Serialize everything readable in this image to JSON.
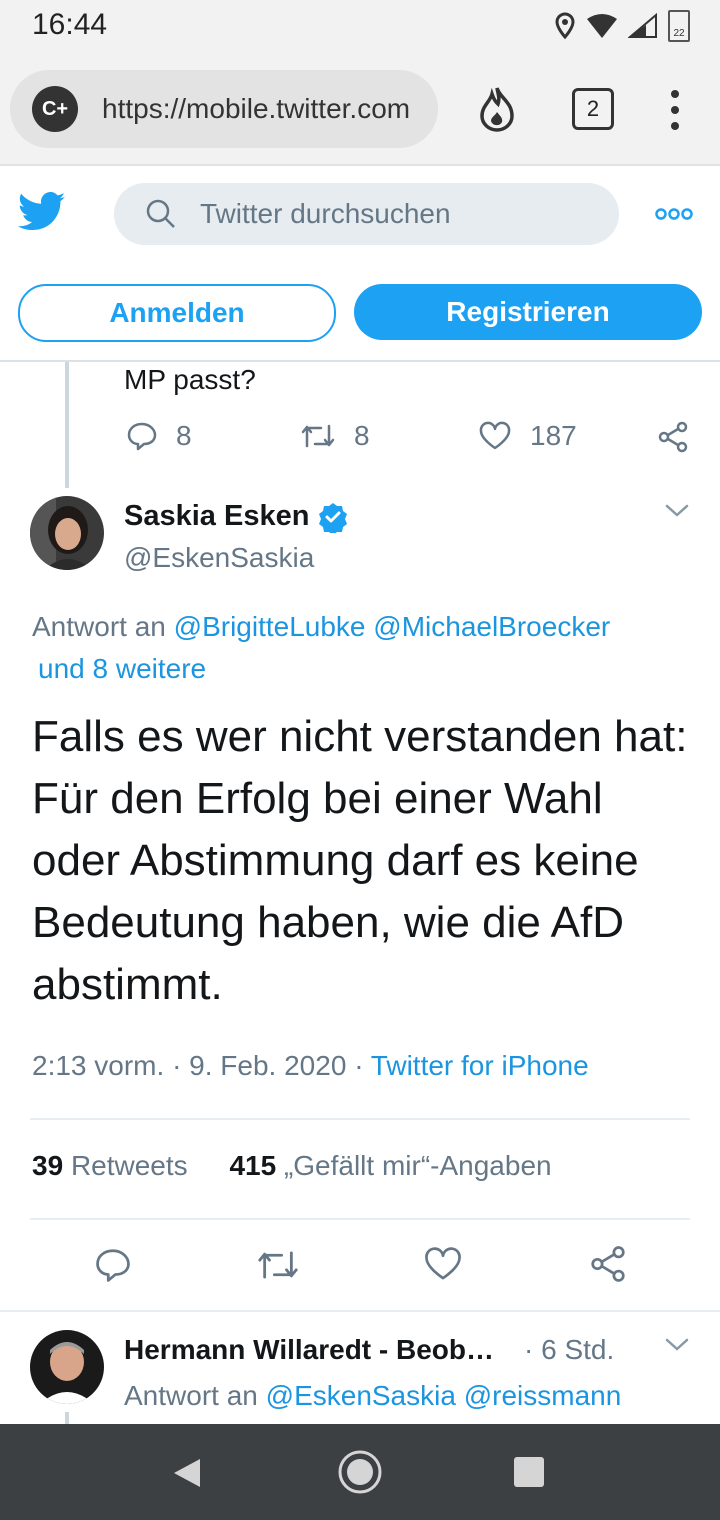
{
  "status_bar": {
    "time": "16:44",
    "battery_level": "22"
  },
  "browser": {
    "logo_text": "C+",
    "url": "https://mobile.twitter.com",
    "tab_count": "2"
  },
  "header": {
    "search_placeholder": "Twitter durchsuchen",
    "login_label": "Anmelden",
    "signup_label": "Registrieren"
  },
  "previous_tweet": {
    "text_tail": "MP passt?",
    "replies": "8",
    "retweets": "8",
    "likes": "187"
  },
  "tweet": {
    "author_name": "Saskia Esken",
    "author_handle": "@EskenSaskia",
    "reply_prefix": "Antwort an",
    "reply_mentions": "@BrigitteLubke @MichaelBroecker",
    "reply_more": "und 8 weitere",
    "text": "Falls es wer nicht verstanden hat: Für den Erfolg bei einer Wahl oder Abstimmung darf es keine Bedeutung haben, wie die AfD abstimmt.",
    "time": "2:13 vorm.",
    "separator": "·",
    "date": "9. Feb. 2020",
    "source": "Twitter for iPhone",
    "retweet_count": "39",
    "retweet_label": "Retweets",
    "like_count": "415",
    "like_label": "„Gefällt mir“-Angaben"
  },
  "next_reply": {
    "author_name": "Hermann Willaredt - Beobachter",
    "time": "· 6 Std.",
    "reply_prefix": "Antwort an",
    "reply_mentions": "@EskenSaskia @reissmann"
  },
  "colors": {
    "brand_blue": "#1da1f2",
    "link_blue": "#1b95e0",
    "secondary_text": "#657786",
    "nav_bar": "#3c4043"
  },
  "icons": [
    "location-icon",
    "wifi-icon",
    "signal-icon",
    "battery-icon",
    "flame-icon",
    "tabs-icon",
    "overflow-menu-icon",
    "twitter-bird-icon",
    "search-icon",
    "more-icon",
    "reply-icon",
    "retweet-icon",
    "like-icon",
    "share-icon",
    "verified-icon",
    "chevron-down-icon",
    "nav-back-icon",
    "nav-home-icon",
    "nav-recents-icon"
  ]
}
